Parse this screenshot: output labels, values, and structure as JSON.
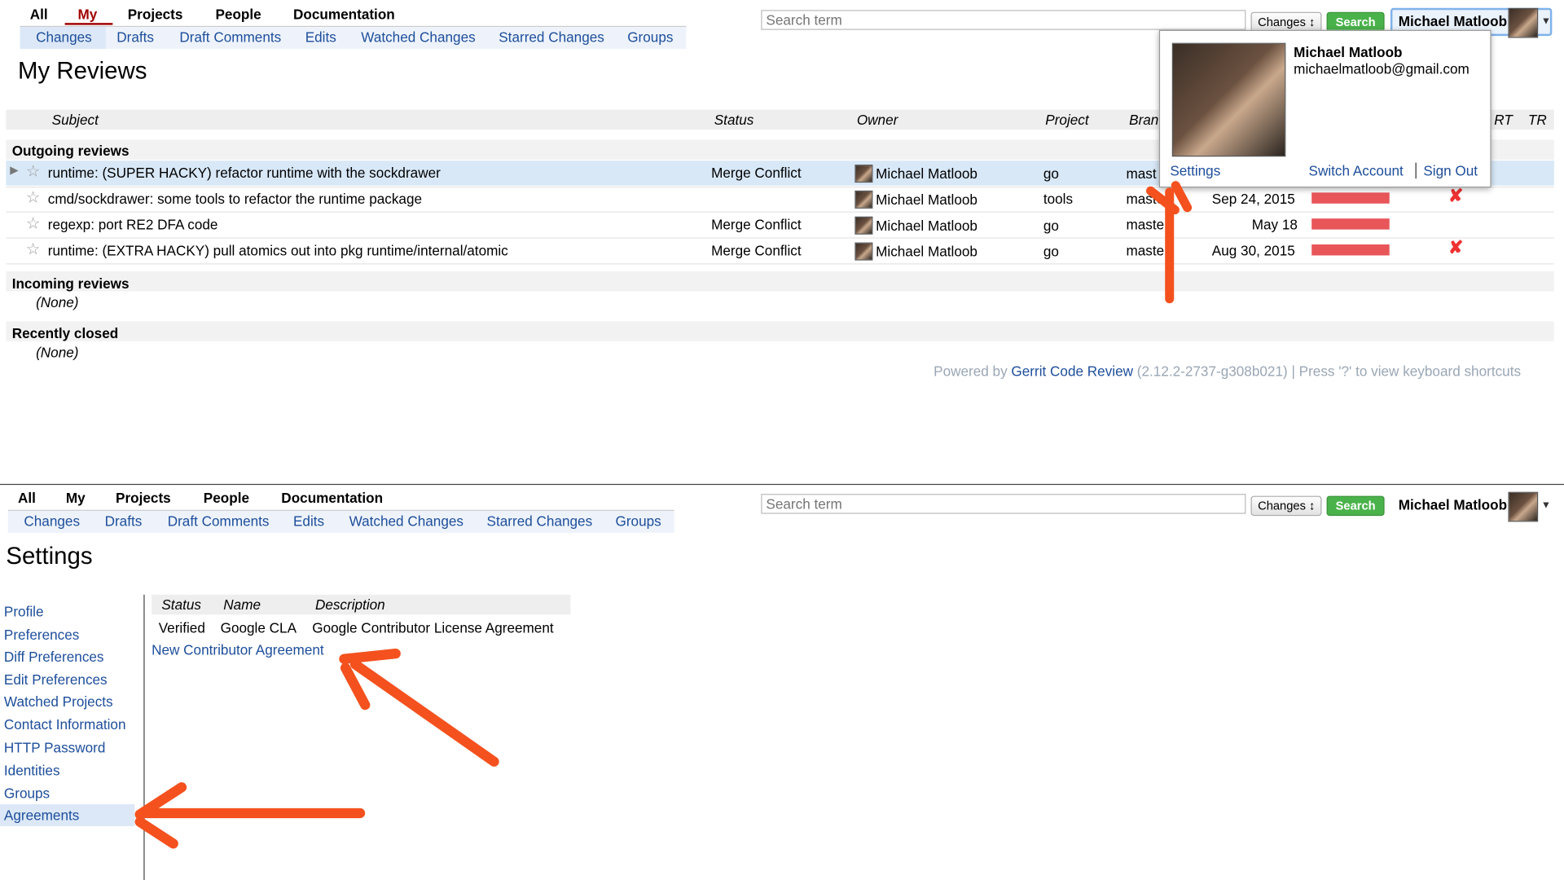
{
  "top_nav": [
    "All",
    "My",
    "Projects",
    "People",
    "Documentation"
  ],
  "sub_nav": [
    "Changes",
    "Drafts",
    "Draft Comments",
    "Edits",
    "Watched Changes",
    "Starred Changes",
    "Groups"
  ],
  "search": {
    "placeholder": "Search term",
    "scope": "Changes ↕",
    "button": "Search"
  },
  "user": {
    "name": "Michael Matloob",
    "email": "michaelmatloob@gmail.com"
  },
  "popup": {
    "settings": "Settings",
    "switch_account": "Switch Account",
    "sign_out": "Sign Out"
  },
  "reviews_page": {
    "title": "My Reviews",
    "columns": [
      "Subject",
      "Status",
      "Owner",
      "Project",
      "Bran",
      "RT",
      "TR"
    ],
    "sections": {
      "outgoing": "Outgoing reviews",
      "incoming": "Incoming reviews",
      "closed": "Recently closed",
      "none": "(None)"
    },
    "rows": [
      {
        "subject": "runtime: (SUPER HACKY) refactor runtime with the sockdrawer",
        "status": "Merge Conflict",
        "owner": "Michael Matloob",
        "project": "go",
        "branch": "mast",
        "updated": ""
      },
      {
        "subject": "cmd/sockdrawer: some tools to refactor the runtime package",
        "status": "",
        "owner": "Michael Matloob",
        "project": "tools",
        "branch": "maste",
        "updated": "Sep 24, 2015"
      },
      {
        "subject": "regexp: port RE2 DFA code",
        "status": "Merge Conflict",
        "owner": "Michael Matloob",
        "project": "go",
        "branch": "maste",
        "updated": "May 18"
      },
      {
        "subject": "runtime: (EXTRA HACKY) pull atomics out into pkg runtime/internal/atomic",
        "status": "Merge Conflict",
        "owner": "Michael Matloob",
        "project": "go",
        "branch": "maste",
        "updated": "Aug 30, 2015"
      }
    ],
    "footer": {
      "prefix": "Powered by ",
      "link": "Gerrit Code Review",
      "suffix": " (2.12.2-2737-g308b021) | Press '?' to view keyboard shortcuts"
    }
  },
  "settings_page": {
    "title": "Settings",
    "nav": [
      "Profile",
      "Preferences",
      "Diff Preferences",
      "Edit Preferences",
      "Watched Projects",
      "Contact Information",
      "HTTP Password",
      "Identities",
      "Groups",
      "Agreements"
    ],
    "agreements": {
      "columns": [
        "Status",
        "Name",
        "Description"
      ],
      "row": {
        "status": "Verified",
        "name": "Google CLA",
        "description": "Google Contributor License Agreement"
      },
      "new_link": "New Contributor Agreement"
    }
  },
  "colors": {
    "link": "#1d4e9b",
    "search_button": "#4ab24a",
    "arrow": "#f4511e",
    "active_tab": "#a00000",
    "score_bar": "#e8565a"
  }
}
